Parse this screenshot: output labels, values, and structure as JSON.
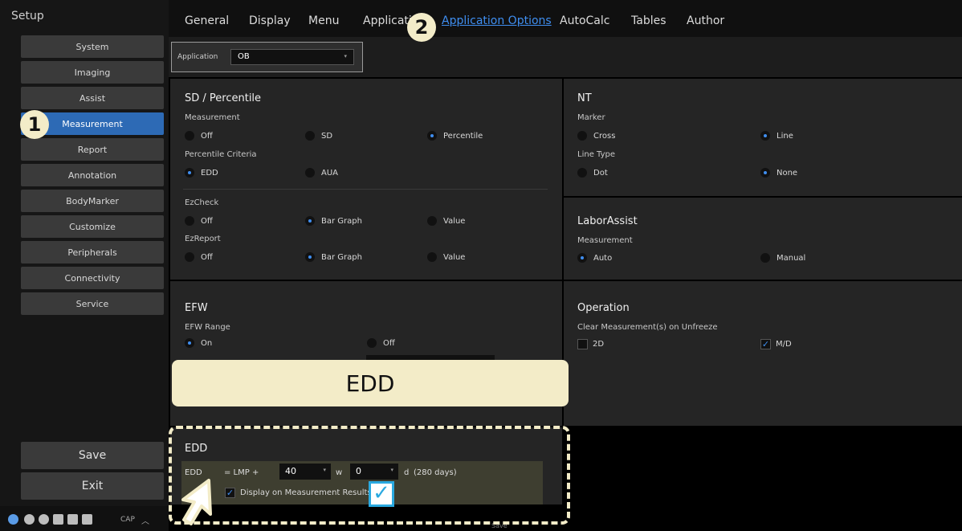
{
  "sidebar": {
    "title": "Setup",
    "items": [
      {
        "label": "System"
      },
      {
        "label": "Imaging"
      },
      {
        "label": "Assist"
      },
      {
        "label": "Measurement"
      },
      {
        "label": "Report"
      },
      {
        "label": "Annotation"
      },
      {
        "label": "BodyMarker"
      },
      {
        "label": "Customize"
      },
      {
        "label": "Peripherals"
      },
      {
        "label": "Connectivity"
      },
      {
        "label": "Service"
      }
    ],
    "save_label": "Save",
    "exit_label": "Exit",
    "cap_label": "CAP"
  },
  "tabs": [
    "General",
    "Display",
    "Menu",
    "Applicati",
    "Application Options",
    "AutoCalc",
    "Tables",
    "Author"
  ],
  "callouts": {
    "one": "1",
    "two": "2",
    "edd_banner": "EDD"
  },
  "application": {
    "label": "Application",
    "value": "OB"
  },
  "sd_percentile": {
    "title": "SD / Percentile",
    "measurement_label": "Measurement",
    "measurement_options": [
      "Off",
      "SD",
      "Percentile"
    ],
    "percentile_label": "Percentile Criteria",
    "percentile_options": [
      "EDD",
      "AUA"
    ]
  },
  "ezcheck": {
    "label": "EzCheck",
    "options": [
      "Off",
      "Bar Graph",
      "Value"
    ]
  },
  "ezreport": {
    "label": "EzReport",
    "options": [
      "Off",
      "Bar Graph",
      "Value"
    ]
  },
  "nt": {
    "title": "NT",
    "marker_label": "Marker",
    "marker_options": [
      "Cross",
      "Line"
    ],
    "linetype_label": "Line Type",
    "linetype_options": [
      "Dot",
      "None"
    ]
  },
  "laborassist": {
    "title": "LaborAssist",
    "measurement_label": "Measurement",
    "options": [
      "Auto",
      "Manual"
    ]
  },
  "efw": {
    "title": "EFW",
    "range_label": "EFW Range",
    "options": [
      "On",
      "Off"
    ]
  },
  "operation": {
    "title": "Operation",
    "clear_label": "Clear Measurement(s) on Unfreeze",
    "options": [
      "2D",
      "M/D"
    ]
  },
  "edd": {
    "title": "EDD",
    "row_label": "EDD",
    "equals": "= LMP +",
    "weeks_value": "40",
    "weeks_unit": "w",
    "days_value": "0",
    "days_unit": "d",
    "days_note": "(280 days)",
    "display_check_label": "Display on Measurement Results"
  },
  "bottom_save_label": "Save"
}
